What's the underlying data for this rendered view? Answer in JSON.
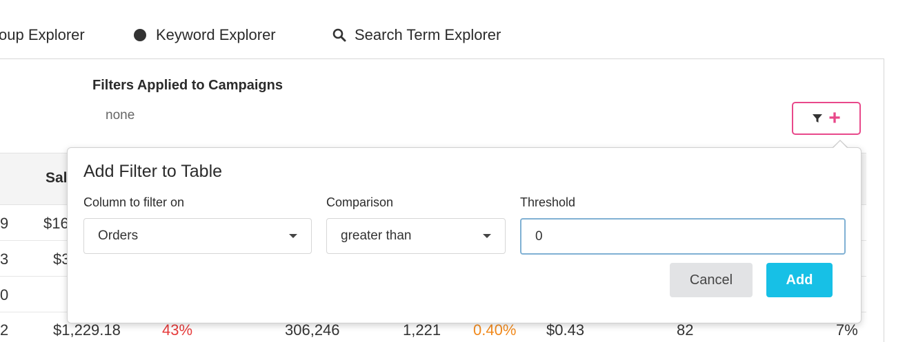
{
  "nav": {
    "tabs": [
      {
        "label": "oup Explorer"
      },
      {
        "label": "Keyword Explorer"
      },
      {
        "label": "Search Term Explorer"
      }
    ]
  },
  "filters": {
    "title": "Filters Applied to Campaigns",
    "value": "none",
    "plus": "+"
  },
  "table": {
    "header_partial": "Sal",
    "rows": [
      {
        "a": "9",
        "b": "$16"
      },
      {
        "a": "3",
        "b": "$3"
      },
      {
        "a": "0",
        "b": ""
      },
      {
        "a": "2",
        "b": "$1,229.18",
        "c": "43%",
        "d": "306,246",
        "e": "1,221",
        "f": "0.40%",
        "g": "$0.43",
        "h": "82",
        "i": "7%"
      }
    ]
  },
  "popover": {
    "title": "Add Filter to Table",
    "column_label": "Column to filter on",
    "column_value": "Orders",
    "comparison_label": "Comparison",
    "comparison_value": "greater than",
    "threshold_label": "Threshold",
    "threshold_value": "0",
    "cancel_label": "Cancel",
    "add_label": "Add"
  },
  "colors": {
    "accent_pink": "#e8488a",
    "add_button": "#17c0e6",
    "negative": "#e63b3b",
    "warning": "#f28a1d"
  }
}
